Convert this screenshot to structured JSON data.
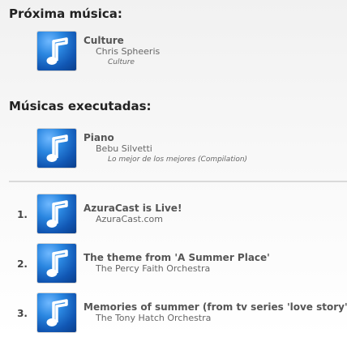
{
  "next": {
    "heading": "Próxima música:",
    "track": {
      "title": "Culture",
      "artist": "Chris Spheeris",
      "album": "Culture",
      "cover_icon": "music-note-icon"
    }
  },
  "played": {
    "heading": "Músicas executadas:",
    "track": {
      "title": "Piano",
      "artist": "Bebu Silvetti",
      "album": "Lo mejor de los mejores (Compilation)",
      "cover_icon": "music-note-icon"
    }
  },
  "list": [
    {
      "number": "1.",
      "title": "AzuraCast is Live!",
      "artist": "AzuraCast.com",
      "cover_icon": "music-note-icon"
    },
    {
      "number": "2.",
      "title": "The theme from 'A Summer Place'",
      "artist": "The Percy Faith Orchestra",
      "cover_icon": "music-note-icon"
    },
    {
      "number": "3.",
      "title": "Memories of summer (from tv series 'love story')",
      "artist": "The Tony Hatch Orchestra",
      "cover_icon": "music-note-icon"
    }
  ],
  "colors": {
    "cover_blue": "#1a6fd1",
    "heading": "#222222",
    "text": "#555555"
  }
}
